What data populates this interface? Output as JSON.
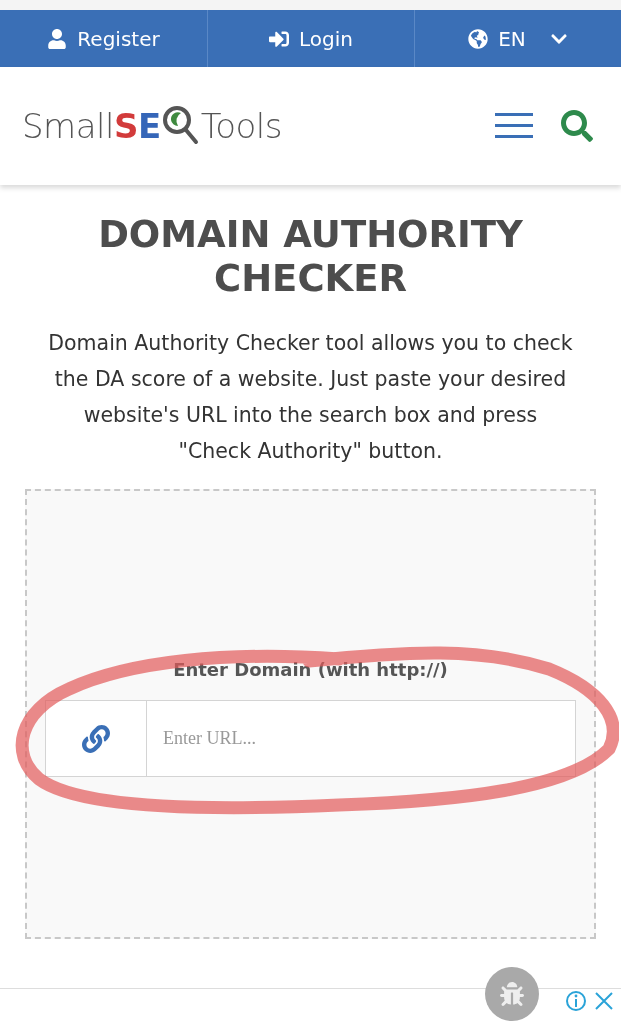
{
  "top_bar": {
    "items": [
      {
        "kind": "register",
        "label": "Register"
      },
      {
        "kind": "login",
        "label": "Login"
      },
      {
        "kind": "language",
        "label": "EN"
      }
    ]
  },
  "header": {
    "logo": {
      "part_1": "Small",
      "part_2": "S",
      "part_3": "E",
      "part_4": "Tools"
    }
  },
  "main": {
    "title": "DOMAIN AUTHORITY CHECKER",
    "description": "Domain Authority Checker tool allows you to check the DA score of a website. Just paste your desired website's URL into the search box and press \"Check Authority\" button.",
    "field_label": "Enter Domain (with http://)",
    "url_field": {
      "placeholder": "Enter URL..."
    }
  }
}
